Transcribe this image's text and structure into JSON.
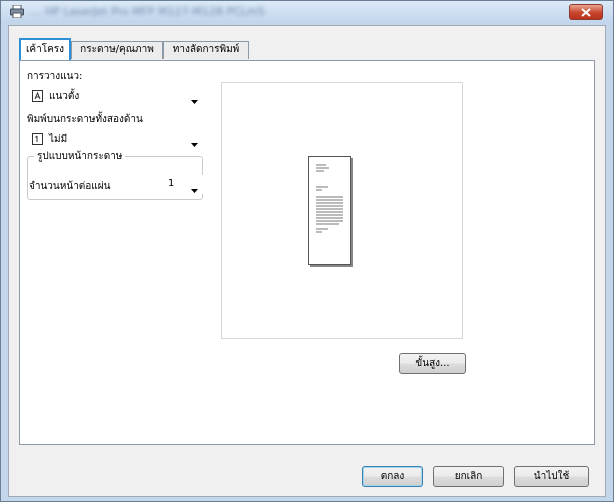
{
  "window": {
    "title_left": "...",
    "title_right": "HP LaserJet Pro MFP M127-M128 PCLmS"
  },
  "tabs": [
    {
      "label": "เค้าโครง"
    },
    {
      "label": "กระดาษ/คุณภาพ"
    },
    {
      "label": "ทางลัดการพิมพ์"
    }
  ],
  "layout": {
    "orientation_label": "การวางแนว:",
    "orientation_value": "แนวตั้ง",
    "duplex_label": "พิมพ์บนกระดาษทั้งสองด้าน",
    "duplex_value": "ไม่มี",
    "page_format_group": "รูปแบบหน้ากระดาษ",
    "pages_per_sheet_label": "จำนวนหน้าต่อแผ่น",
    "pages_per_sheet_value": "1"
  },
  "buttons": {
    "advanced": "ขั้นสูง...",
    "ok": "ตกลง",
    "cancel": "ยกเลิก",
    "apply": "นำไปใช้"
  },
  "colors": {
    "active_tab_border": "#2f8fd6",
    "close_button": "#c8442c"
  }
}
